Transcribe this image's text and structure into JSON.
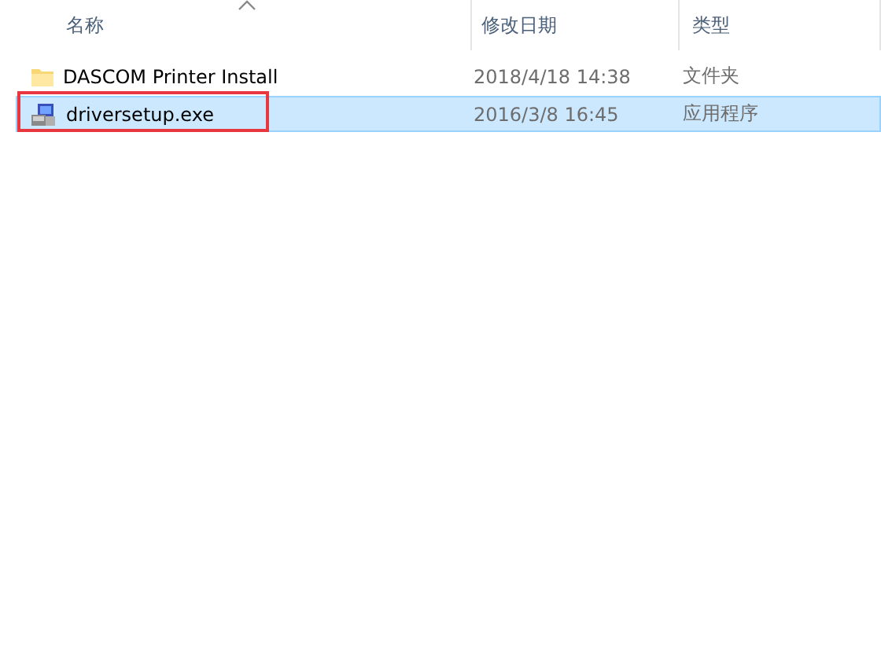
{
  "columns": [
    {
      "label": "名称",
      "sorted": true
    },
    {
      "label": "修改日期",
      "sorted": false
    },
    {
      "label": "类型",
      "sorted": false
    }
  ],
  "rows": [
    {
      "kind": "folder",
      "name": "DASCOM Printer Install",
      "date": "2018/4/18 14:38",
      "type": "文件夹",
      "selected": false,
      "highlighted": false
    },
    {
      "kind": "exe",
      "name": "driversetup.exe",
      "date": "2016/3/8 16:45",
      "type": "应用程序",
      "selected": true,
      "highlighted": true
    }
  ]
}
